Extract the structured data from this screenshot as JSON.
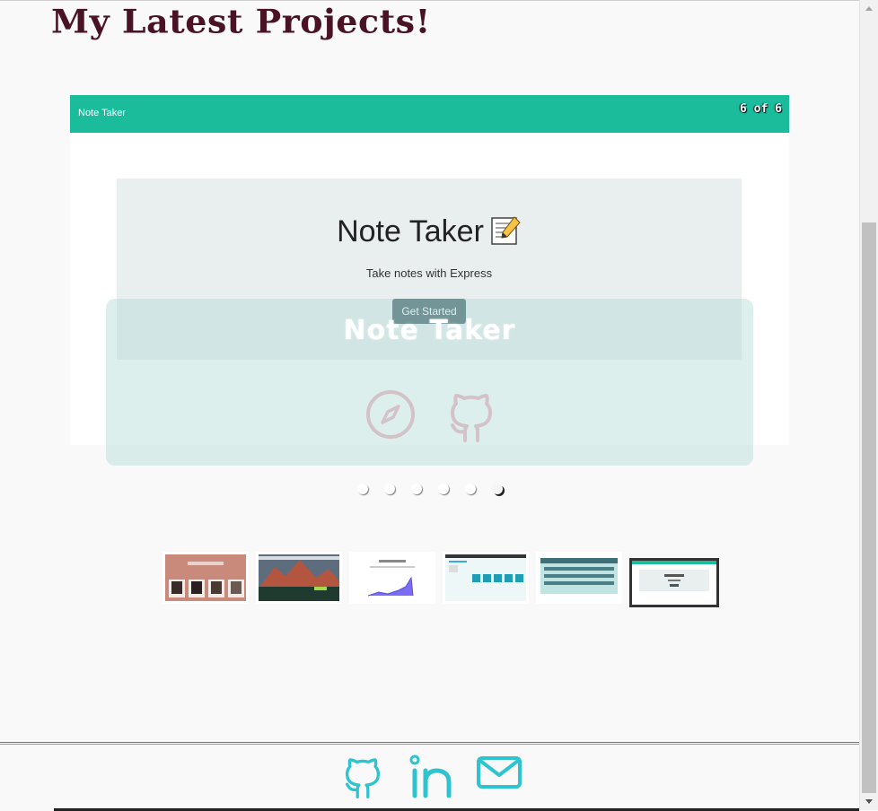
{
  "page": {
    "heading": "My Latest Projects!"
  },
  "slide": {
    "nav_brand": "Note Taker",
    "counter": "6 of 6",
    "jumbotron_title": "Note Taker",
    "jumbotron_icon": "memo-icon",
    "jumbotron_subtitle": "Take notes with Express",
    "cta_label": "Get Started",
    "caption_title": "Note Taker",
    "caption_icons": [
      "compass-icon",
      "github-icon"
    ]
  },
  "carousel": {
    "slide_count": 6,
    "active_index": 5
  },
  "thumbnails": [
    {
      "name": "thumb-1",
      "theme": "portraits"
    },
    {
      "name": "thumb-2",
      "theme": "mountain-landscape"
    },
    {
      "name": "thumb-3",
      "theme": "chart-page"
    },
    {
      "name": "thumb-4",
      "theme": "dashboard"
    },
    {
      "name": "thumb-5",
      "theme": "form-app"
    },
    {
      "name": "thumb-6",
      "theme": "note-taker",
      "active": true
    }
  ],
  "footer": {
    "icons": [
      "github-icon",
      "linkedin-icon",
      "mail-icon"
    ]
  },
  "colors": {
    "heading": "#4a1325",
    "nav": "#1abc9c",
    "caption_bg": "#b4dbd6",
    "footer_icons": "#2ec4cf",
    "cta": "#3e5b63"
  }
}
